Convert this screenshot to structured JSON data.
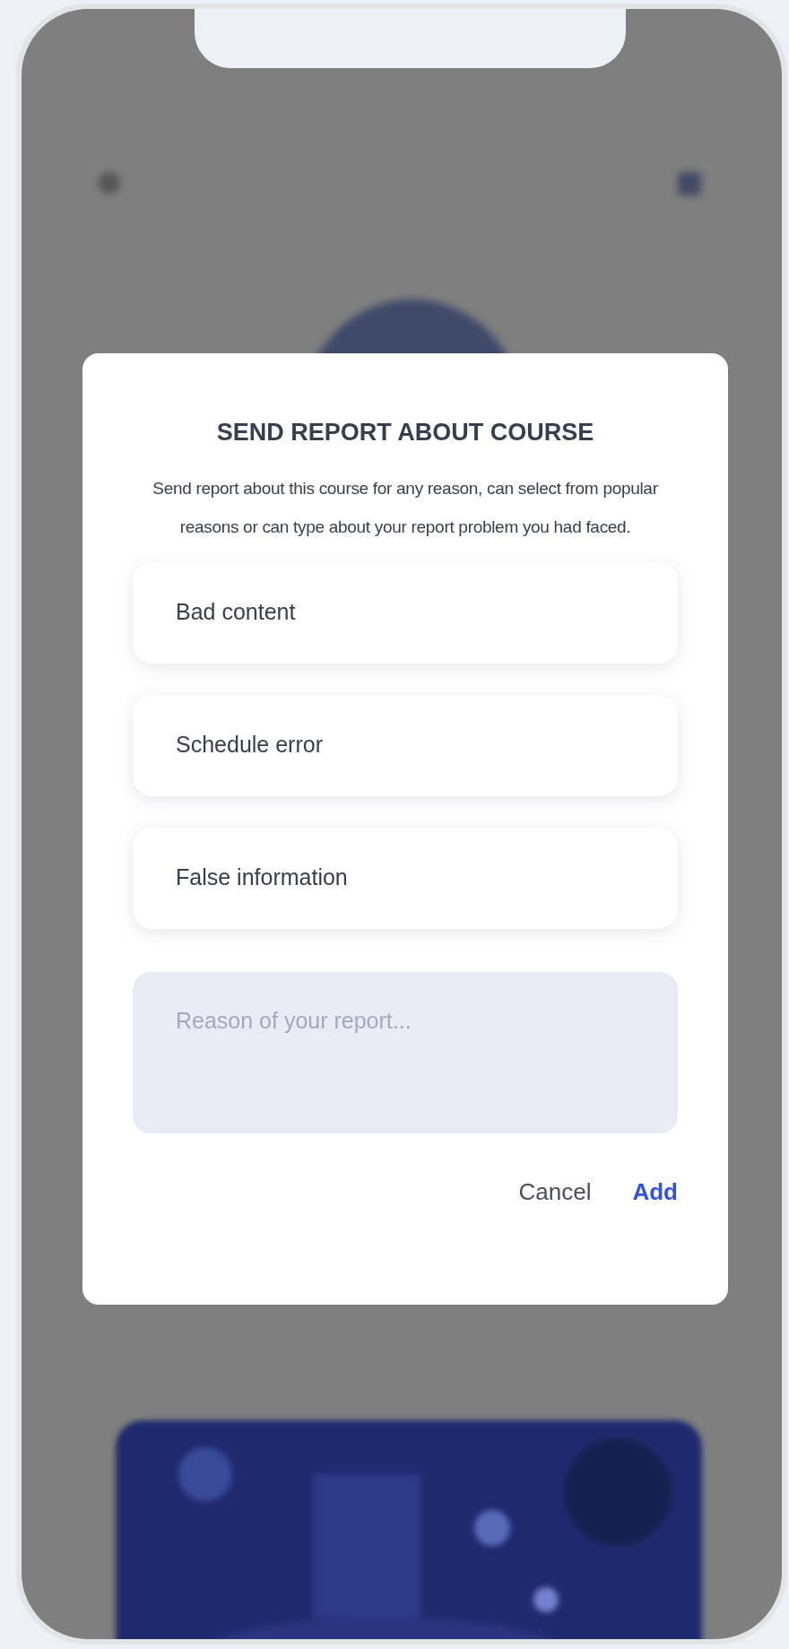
{
  "dialog": {
    "title": "SEND REPORT ABOUT COURSE",
    "description": "Send report about this course for any reason, can select from popular reasons or can type about your report problem you had faced.",
    "reasons": [
      {
        "label": "Bad content"
      },
      {
        "label": "Schedule error"
      },
      {
        "label": "False information"
      }
    ],
    "reason_field": {
      "placeholder": "Reason of your report..."
    },
    "buttons": [
      {
        "label": "Cancel",
        "kind": "secondary"
      },
      {
        "label": "Add",
        "kind": "primary"
      }
    ]
  }
}
